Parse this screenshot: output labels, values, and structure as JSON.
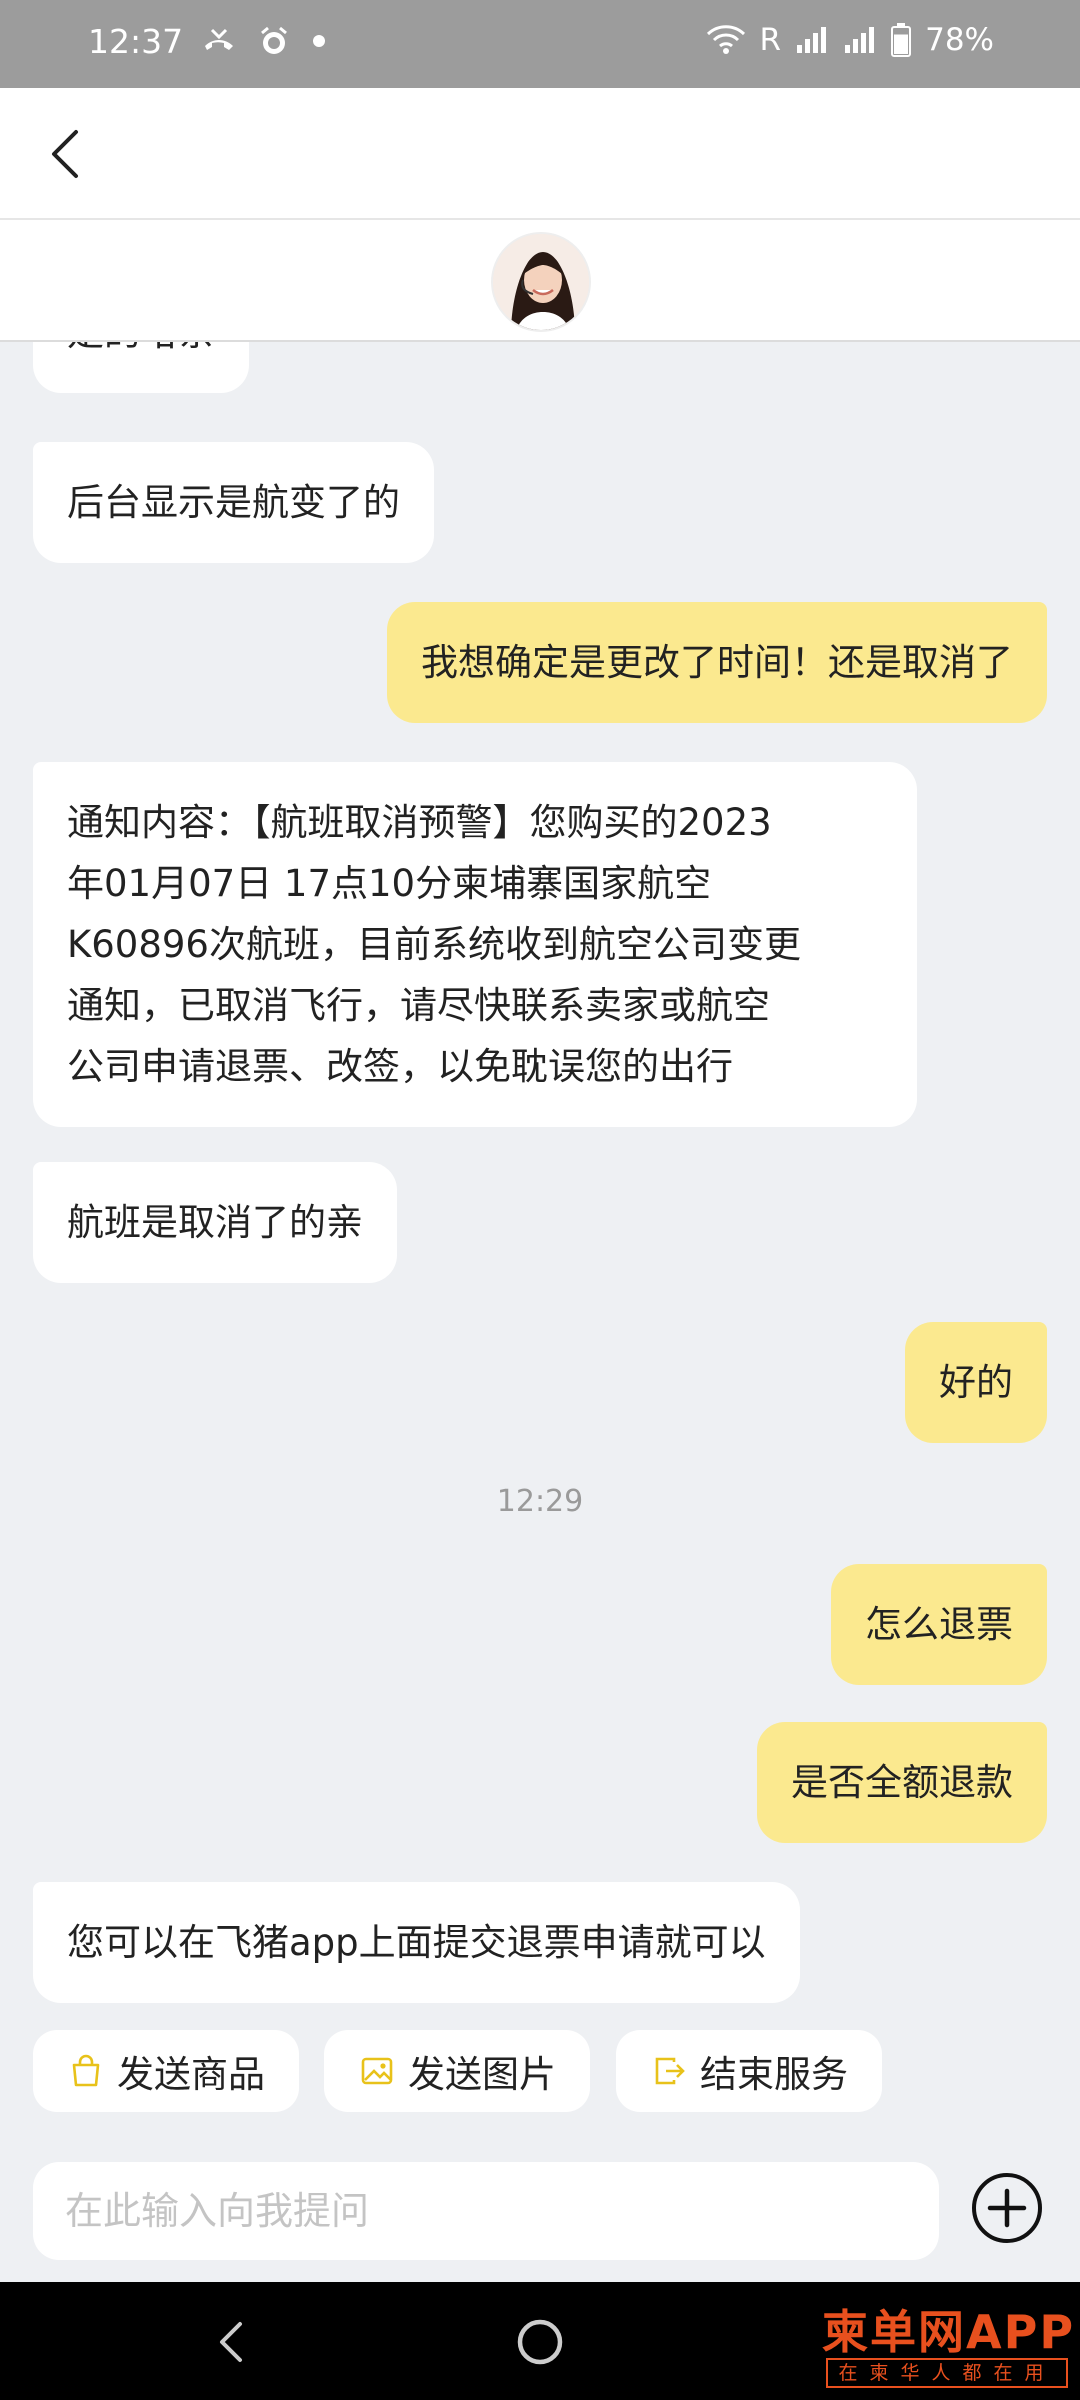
{
  "status_bar": {
    "time": "12:37",
    "left_icons": [
      "missed-call-icon",
      "alarm-icon",
      "dot-icon"
    ],
    "roaming": "R",
    "battery": "78%",
    "battery_level": 0.78
  },
  "agent": {
    "avatar_icon": "agent-avatar-icon"
  },
  "messages": [
    {
      "side": "in",
      "text": "是的哈亲"
    },
    {
      "side": "in",
      "text": "后台显示是航变了的"
    },
    {
      "side": "out",
      "text": "我想确定是更改了时间！还是取消了"
    },
    {
      "side": "in",
      "text": "通知内容：【航班取消预警】您购买的2023\n年01月07日 17点10分柬埔寨国家航空\nK60896次航班，目前系统收到航空公司变更\n通知，已取消飞行，请尽快联系卖家或航空\n公司申请退票、改签，以免耽误您的出行"
    },
    {
      "side": "in",
      "text": "航班是取消了的亲"
    },
    {
      "side": "out",
      "text": "好的"
    },
    {
      "side": "out",
      "text": "怎么退票"
    },
    {
      "side": "out",
      "text": "是否全额退款"
    },
    {
      "side": "in",
      "text": "您可以在飞猪app上面提交退票申请就可以"
    }
  ],
  "time_separator": "12:29",
  "quick_actions": {
    "send_product": "发送商品",
    "send_image": "发送图片",
    "end_service": "结束服务"
  },
  "input": {
    "placeholder": "在此输入向我提问"
  },
  "watermark": {
    "main": "柬单网APP",
    "sub": "在柬华人都在用"
  },
  "colors": {
    "outgoing_bubble": "#fbe98f",
    "incoming_bubble": "#ffffff",
    "accent_icon": "#e8c21a",
    "watermark": "#e8501e"
  }
}
